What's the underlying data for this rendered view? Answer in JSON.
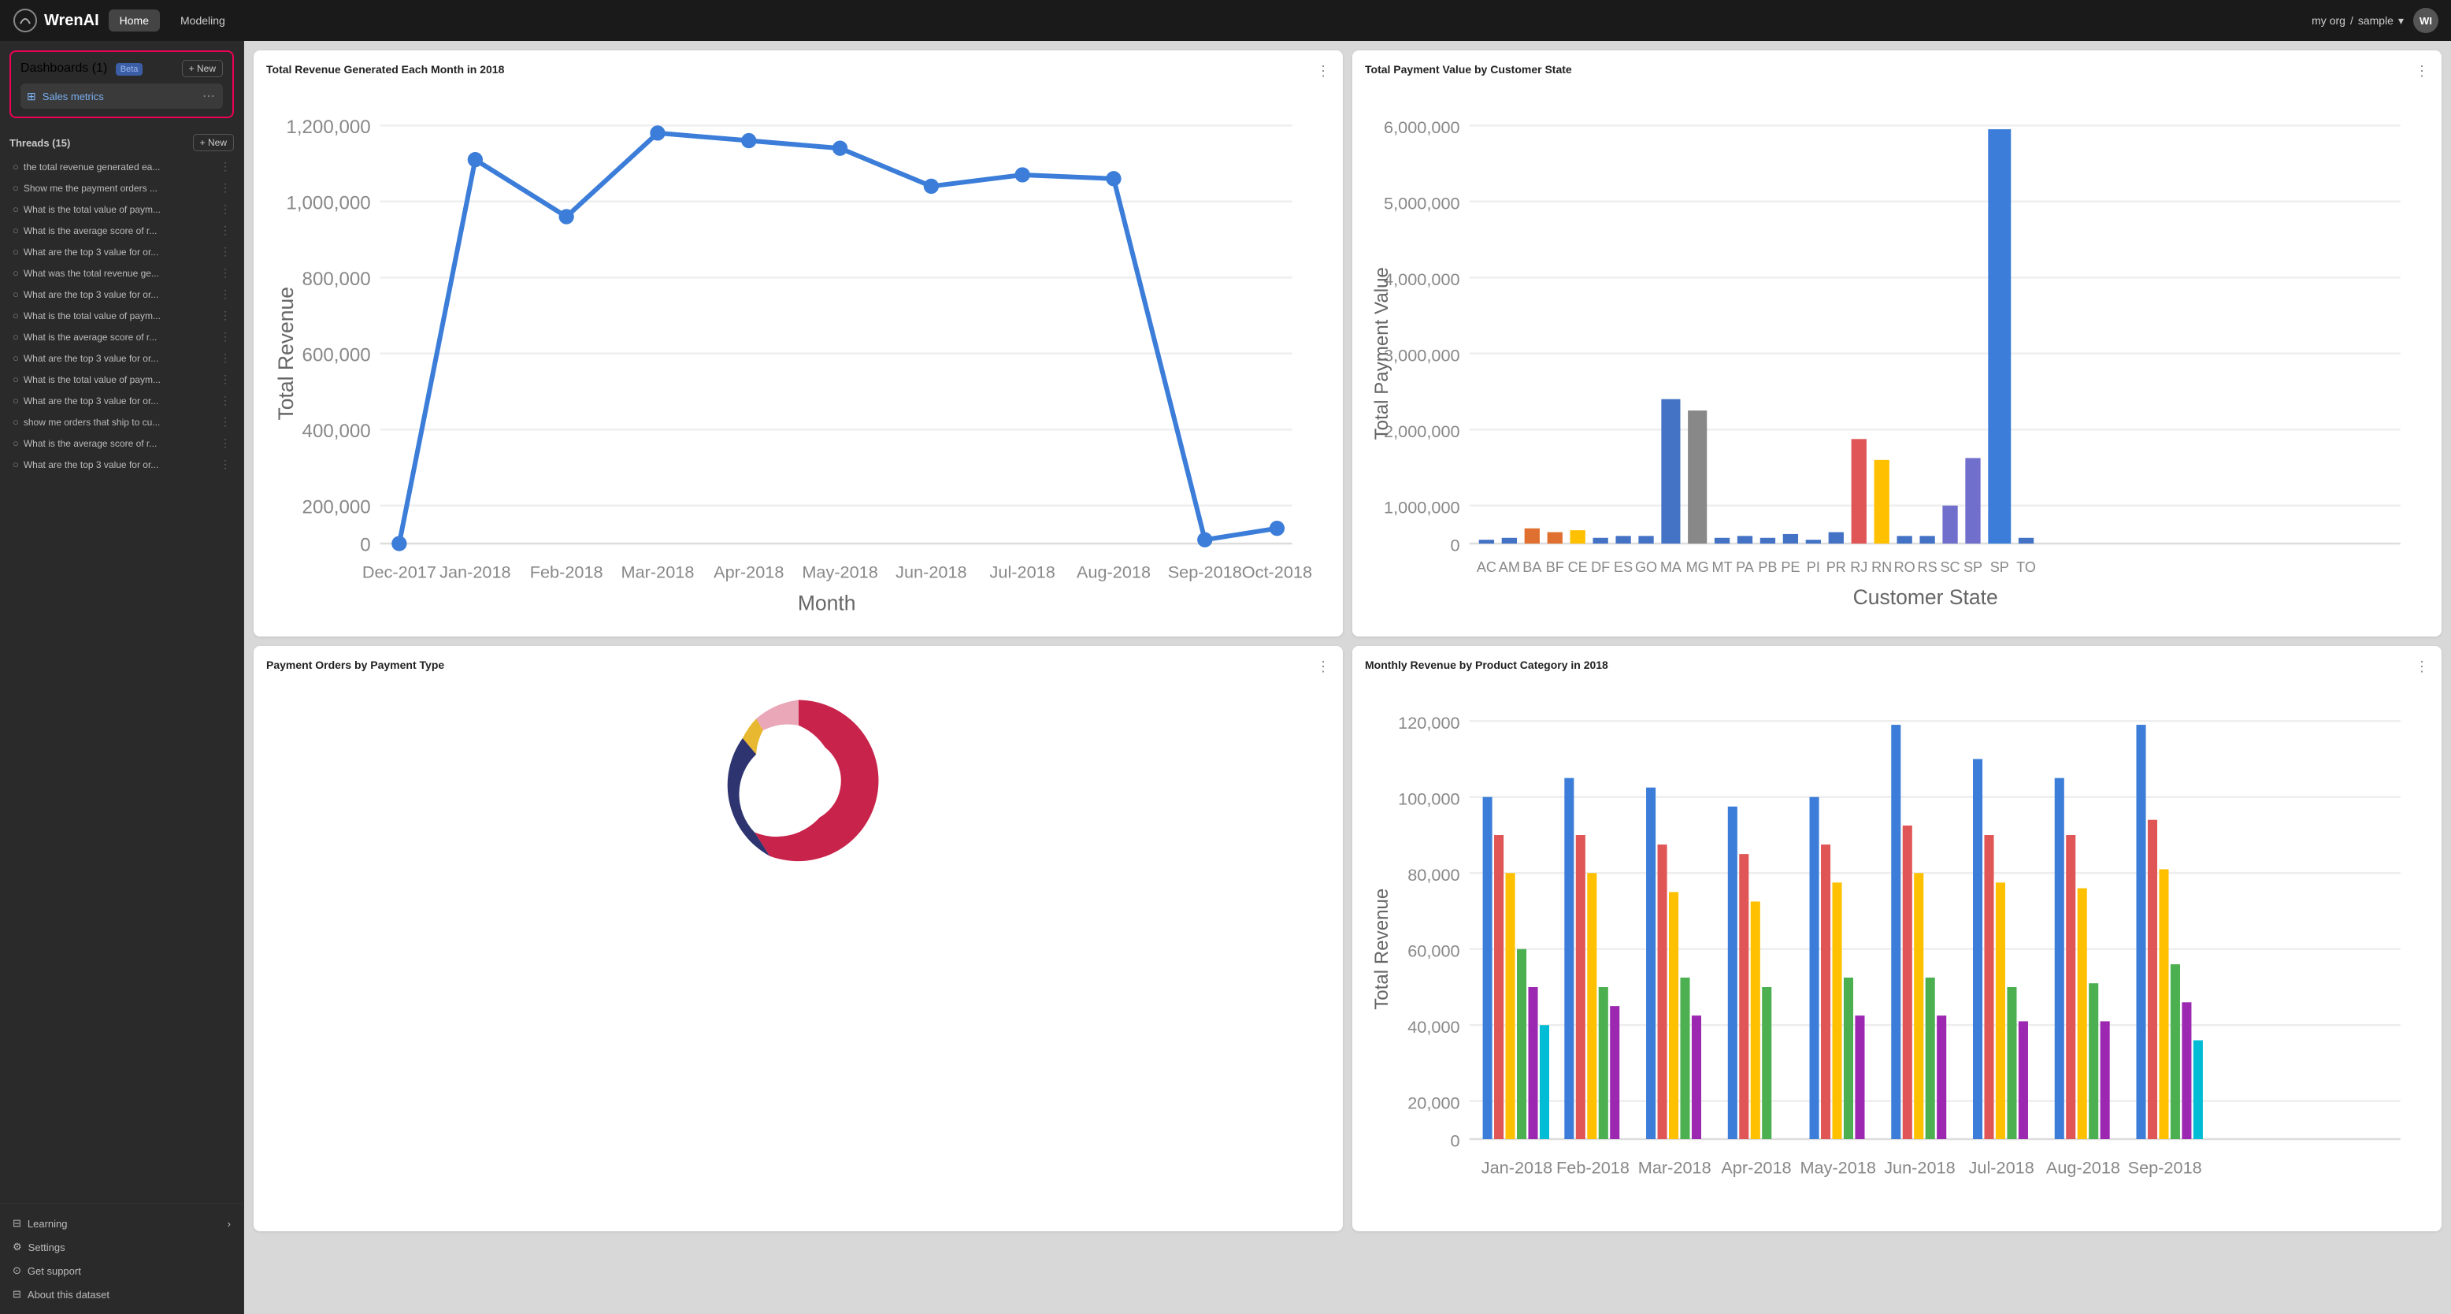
{
  "topnav": {
    "logo_text": "WrenAI",
    "nav_items": [
      {
        "label": "Home",
        "active": true
      },
      {
        "label": "Modeling",
        "active": false
      }
    ],
    "org": "my org",
    "sample": "sample",
    "avatar": "WI"
  },
  "sidebar": {
    "dashboards_label": "Dashboards (1)",
    "beta_label": "Beta",
    "new_label": "+ New",
    "dashboard_item": "Sales metrics",
    "threads_label": "Threads (15)",
    "threads_new_label": "+ New",
    "threads": [
      "the total revenue generated ea...",
      "Show me the payment orders ...",
      "What is the total value of paym...",
      "What is the average score of r...",
      "What are the top 3 value for or...",
      "What was the total revenue ge...",
      "What are the top 3 value for or...",
      "What is the total value of paym...",
      "What is the average score of r...",
      "What are the top 3 value for or...",
      "What is the total value of paym...",
      "What are the top 3 value for or...",
      "show me orders that ship to cu...",
      "What is the average score of r...",
      "What are the top 3 value for or..."
    ],
    "learning_label": "Learning",
    "settings_label": "Settings",
    "support_label": "Get support",
    "dataset_label": "About this dataset"
  },
  "charts": [
    {
      "id": "total-revenue",
      "title": "Total Revenue Generated Each Month in 2018",
      "type": "line"
    },
    {
      "id": "payment-value-state",
      "title": "Total Payment Value by Customer State",
      "type": "bar"
    },
    {
      "id": "payment-orders-type",
      "title": "Payment Orders by Payment Type",
      "type": "donut"
    },
    {
      "id": "monthly-revenue-category",
      "title": "Monthly Revenue by Product Category in 2018",
      "type": "grouped-bar"
    }
  ]
}
